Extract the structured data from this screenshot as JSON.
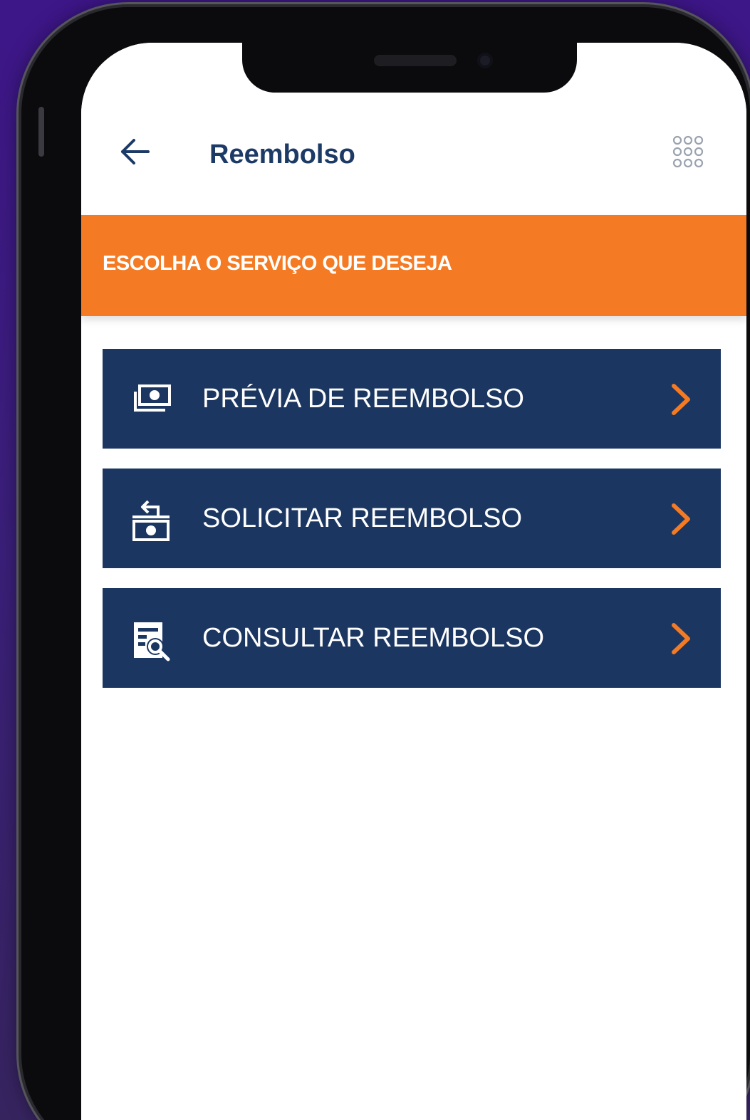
{
  "header": {
    "title": "Reembolso",
    "back_icon": "arrow-left-icon",
    "menu_icon": "grid-dots-icon"
  },
  "banner": {
    "text": "ESCOLHA O SERVIÇO QUE DESEJA",
    "color": "#f47a24"
  },
  "menu": {
    "items": [
      {
        "label": "PRÉVIA DE REEMBOLSO",
        "icon": "money-stack-icon"
      },
      {
        "label": "SOLICITAR REEMBOLSO",
        "icon": "money-return-icon"
      },
      {
        "label": "CONSULTAR REEMBOLSO",
        "icon": "document-search-icon"
      }
    ],
    "item_color": "#1b3660",
    "chevron_color": "#f47a24"
  },
  "colors": {
    "title": "#1c3a66",
    "background": "#3d1688"
  }
}
